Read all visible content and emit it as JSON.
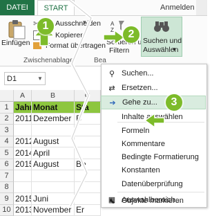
{
  "ribbon": {
    "tabs": [
      {
        "label": "DATEI"
      },
      {
        "label": "START"
      }
    ],
    "signin": "Anmelden",
    "clipboard": {
      "paste": "Einfügen",
      "cut": "Ausschneiden",
      "copy": "Kopieren",
      "format_painter": "Format übertragen",
      "group": "Zwischenablage"
    },
    "edit": {
      "sort": "Sortieren und",
      "filter": "Filtern",
      "find_select_1": "Suchen und",
      "find_select_2": "Auswählen",
      "group_partial": "Bea"
    }
  },
  "formula_bar": {
    "namebox": "D1"
  },
  "grid": {
    "columns": [
      "A",
      "B",
      "C"
    ],
    "rows": [
      {
        "num": "1",
        "a": "Jahr",
        "b": "Monat",
        "c": "Sta"
      },
      {
        "num": "2",
        "a": "2011",
        "b": "Dezember",
        "c": "B"
      },
      {
        "num": "3",
        "a": "",
        "b": "",
        "c": ""
      },
      {
        "num": "4",
        "a": "2012",
        "b": "August",
        "c": ""
      },
      {
        "num": "5",
        "a": "2014",
        "b": "April",
        "c": ""
      },
      {
        "num": "6",
        "a": "2015",
        "b": "August",
        "c": "Be"
      },
      {
        "num": "7",
        "a": "",
        "b": "",
        "c": ""
      },
      {
        "num": "8",
        "a": "",
        "b": "",
        "c": ""
      },
      {
        "num": "9",
        "a": "2015",
        "b": "Juni",
        "c": ""
      },
      {
        "num": "10",
        "a": "2013",
        "b": "November",
        "c": "Er"
      }
    ]
  },
  "menu": {
    "items": [
      {
        "label": "Suchen...",
        "icon": "binoculars-icon"
      },
      {
        "label": "Ersetzen...",
        "icon": "replace-icon"
      },
      {
        "label": "Gehe zu...",
        "icon": "arrow-right-icon"
      },
      {
        "label": "Inhalte auswählen",
        "icon": ""
      },
      {
        "label": "Formeln",
        "icon": ""
      },
      {
        "label": "Kommentare",
        "icon": ""
      },
      {
        "label": "Bedingte Formatierung",
        "icon": ""
      },
      {
        "label": "Konstanten",
        "icon": ""
      },
      {
        "label": "Datenüberprüfung",
        "icon": ""
      },
      {
        "label": "Objekte markieren",
        "icon": "select-objects-icon"
      },
      {
        "label": "Auswahlbereich...",
        "icon": "selection-pane-icon"
      }
    ]
  },
  "steps": [
    "1",
    "2",
    "3"
  ],
  "colors": {
    "excel_green": "#217346",
    "badge_green": "#7dbb2a",
    "header_fill": "#8dc63f",
    "highlight": "#d9ecdf"
  }
}
